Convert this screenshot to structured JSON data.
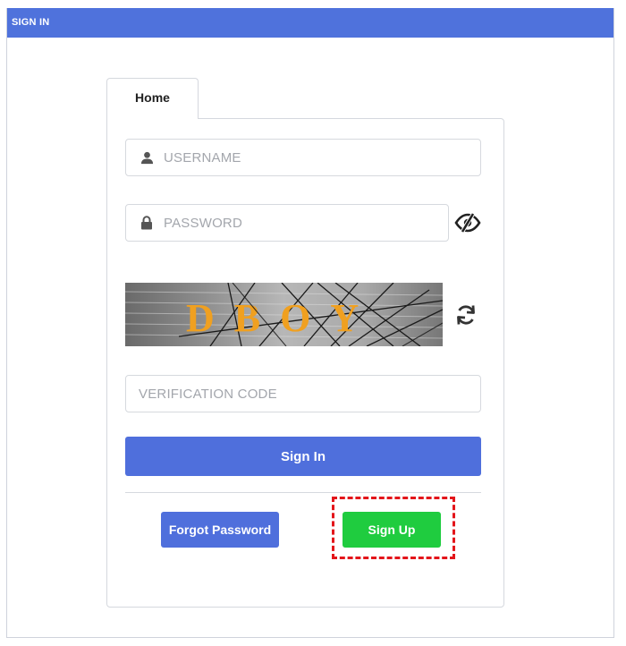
{
  "header": {
    "title": "SIGN IN"
  },
  "tabs": [
    {
      "label": "Home"
    }
  ],
  "form": {
    "username_placeholder": "USERNAME",
    "password_placeholder": "PASSWORD",
    "captcha_text": "DBOY",
    "verification_placeholder": "VERIFICATION CODE",
    "signin_label": "Sign In",
    "forgot_label": "Forgot Password",
    "signup_label": "Sign Up"
  },
  "icons": {
    "username": "user-icon",
    "password": "lock-icon",
    "toggle_visibility": "eye-slash-icon",
    "refresh_captcha": "refresh-icon"
  },
  "colors": {
    "header": "#4f72dc",
    "primary_button": "#4f6fdc",
    "signup_button": "#1fcc3f",
    "highlight_border": "#e3151a",
    "captcha_letters": "#f0a020"
  }
}
